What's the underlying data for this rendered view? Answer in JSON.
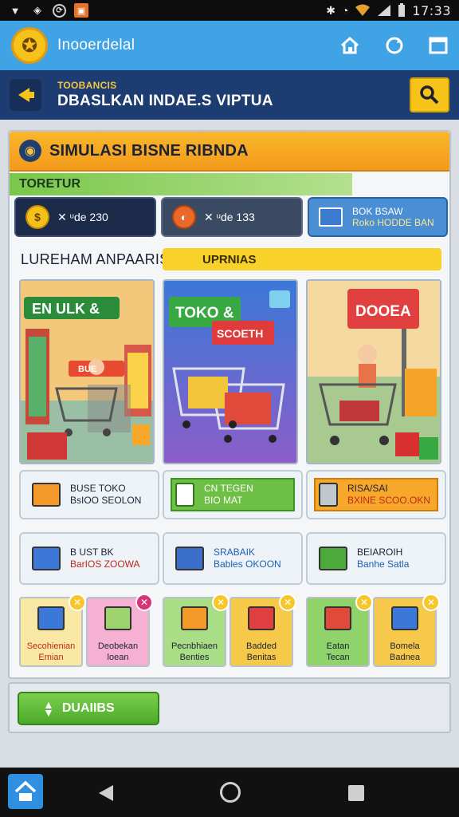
{
  "status_bar": {
    "time": "17:33",
    "left_icons": [
      "download-icon",
      "shield-icon",
      "sync-icon",
      "photo-icon"
    ],
    "right_icons": [
      "bluetooth-icon",
      "alarm-icon",
      "wifi-icon",
      "signal-icon",
      "battery-icon"
    ]
  },
  "app_bar": {
    "title": "Inooerdelal",
    "icons": [
      "home-icon",
      "refresh-icon",
      "window-icon"
    ]
  },
  "sub_header": {
    "small": "TOOBANCIS",
    "big": "DBASLKAN INDAE.S VIPTUA"
  },
  "panel": {
    "title": "SIMULASI BISNE RIBNDA",
    "strip": "TORETUR",
    "stats": [
      {
        "value": "✕ ᵘde 230"
      },
      {
        "value": "✕ ᵘde 133"
      },
      {
        "line1": "BOK BSAW",
        "line2": "Roko HODDE BAN"
      }
    ],
    "section_title": "LUREHAM ANPAARISI",
    "section_pill": "UPRNIAS",
    "scenes": [
      {
        "sign": "EN ULK &",
        "sub": "BUE"
      },
      {
        "sign": "TOKO &",
        "sub": "SCOETH"
      },
      {
        "sign": "DOOEA"
      }
    ],
    "options": [
      {
        "line1": "BUSE TOKO",
        "line2": "BsIOO SEOLON"
      },
      {
        "line1": "CN TEGEN",
        "line2": "BIO MAT"
      },
      {
        "line1": "RISA/SAI",
        "line2": "BXINE SCOO.OKN"
      },
      {
        "line1": "B UST BK",
        "line2": "BarIOS ZOOWA"
      },
      {
        "line1": "SRABAIK",
        "line2": "Bables OKOON"
      },
      {
        "line1": "BEIAROIH",
        "line2": "Banhe Satla"
      }
    ],
    "tiles": [
      {
        "line1": "Secohienian",
        "line2": "Emian"
      },
      {
        "line1": "Deobekan",
        "line2": "loean"
      },
      {
        "line1": "Pecnbhiaen",
        "line2": "Benties"
      },
      {
        "line1": "Badded",
        "line2": "Benitas"
      },
      {
        "line1": "Eatan",
        "line2": "Tecan"
      },
      {
        "line1": "Bomela",
        "line2": "Badnea"
      }
    ]
  },
  "bottom": {
    "button": "DUAIIBS"
  },
  "colors": {
    "app_bar": "#3fa3e6",
    "sub_header": "#1d3d72",
    "accent_orange": "#f39a1a",
    "accent_green": "#6dbf45",
    "accent_yellow": "#f6c419"
  }
}
